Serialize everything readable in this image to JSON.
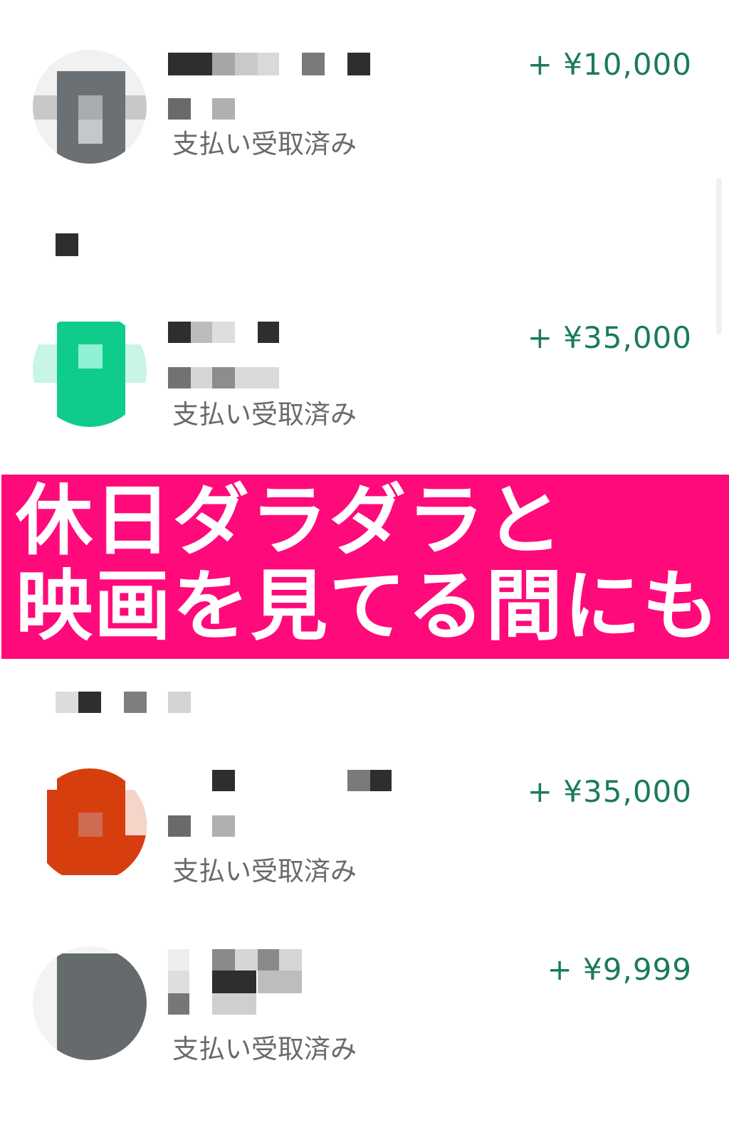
{
  "transactions": [
    {
      "amount": "+ ¥10,000",
      "status": "支払い受取済み"
    },
    {
      "amount": "+ ¥35,000",
      "status": "支払い受取済み"
    },
    {
      "amount": "+ ¥35,000",
      "status": "支払い受取済み"
    },
    {
      "amount": "+ ¥9,999",
      "status": "支払い受取済み"
    }
  ],
  "banner": {
    "line1": "休日ダラダラと",
    "line2": "映画を見てる間にも"
  },
  "colors": {
    "amount": "#1a7a5e",
    "status": "#6a6a6a",
    "banner_bg": "#ff0a7a",
    "banner_text": "#ffffff"
  }
}
